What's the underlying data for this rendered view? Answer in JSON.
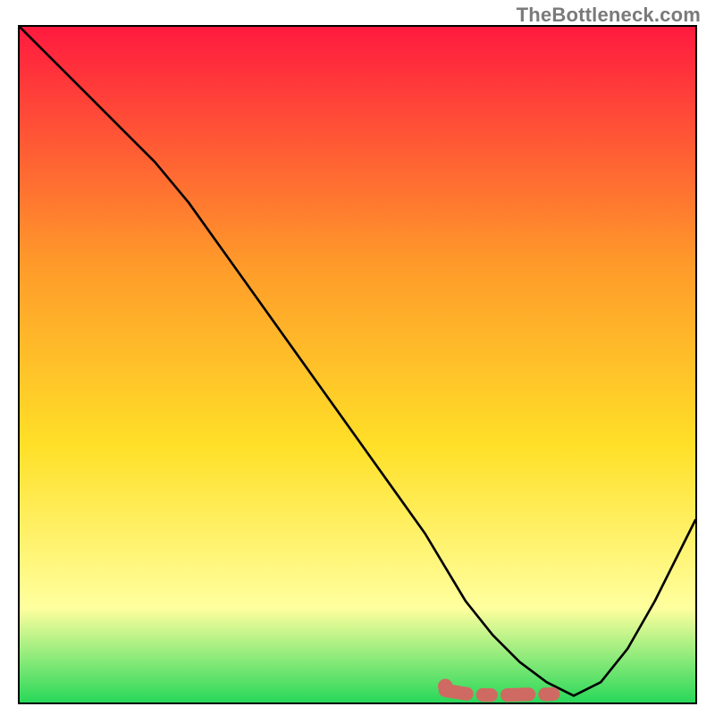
{
  "watermark": {
    "text": "TheBottleneck.com"
  },
  "colors": {
    "frame": "#000000",
    "curve": "#000000",
    "marker": "#cf6a62",
    "grad_top": "#ff1a3f",
    "grad_mid1": "#ff9a2a",
    "grad_mid2": "#ffe028",
    "grad_mid3": "#ffff9e",
    "grad_bottom": "#28d85a"
  },
  "chart_data": {
    "type": "line",
    "title": "",
    "xlabel": "",
    "ylabel": "",
    "xlim": [
      0,
      100
    ],
    "ylim": [
      0,
      100
    ],
    "grid": false,
    "legend": false,
    "series": [
      {
        "name": "bottleneck-curve",
        "x": [
          0,
          5,
          10,
          15,
          20,
          25,
          30,
          35,
          40,
          45,
          50,
          55,
          60,
          63,
          66,
          70,
          74,
          78,
          82,
          86,
          90,
          94,
          98,
          100
        ],
        "y": [
          100,
          95,
          90,
          85,
          80,
          74,
          67,
          60,
          53,
          46,
          39,
          32,
          25,
          20,
          15,
          10,
          6,
          3,
          1,
          3,
          8,
          15,
          23,
          27
        ]
      }
    ],
    "markers": [
      {
        "name": "optimum-segment",
        "shape": "round-dash",
        "x": [
          63,
          66,
          69,
          72,
          75,
          78,
          80
        ],
        "y": [
          1.8,
          1.3,
          1.1,
          1.1,
          1.2,
          1.2,
          1.3
        ]
      }
    ],
    "gradient_stops": [
      {
        "offset": 0.0,
        "color_key": "grad_top"
      },
      {
        "offset": 0.35,
        "color_key": "grad_mid1"
      },
      {
        "offset": 0.62,
        "color_key": "grad_mid2"
      },
      {
        "offset": 0.86,
        "color_key": "grad_mid3"
      },
      {
        "offset": 1.0,
        "color_key": "grad_bottom"
      }
    ]
  }
}
